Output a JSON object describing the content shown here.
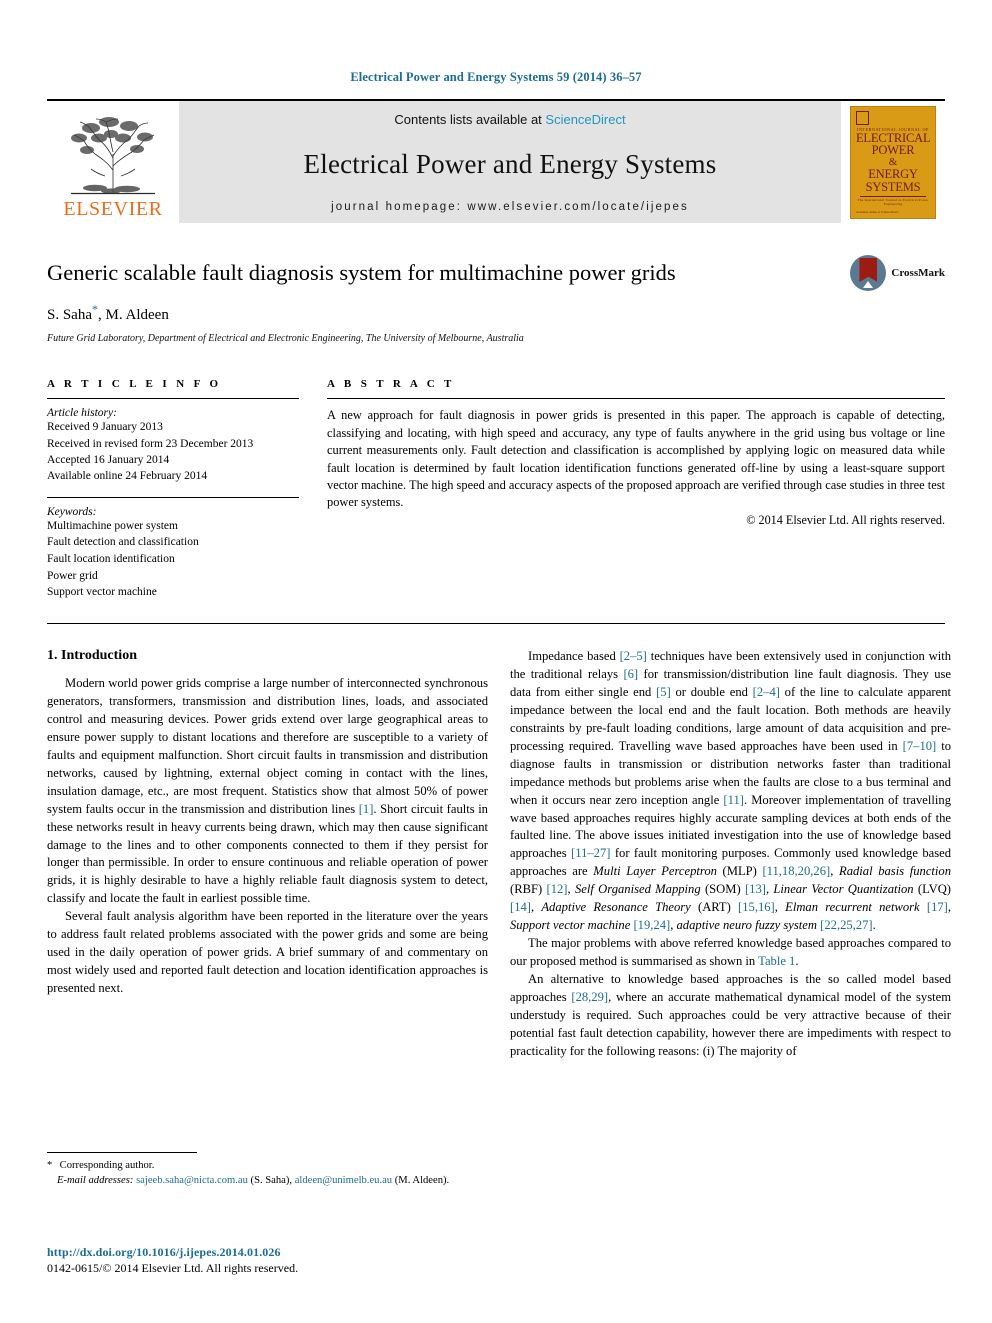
{
  "running_head": "Electrical Power and Energy Systems 59 (2014) 36–57",
  "masthead": {
    "publisher": "ELSEVIER",
    "contents_prefix": "Contents lists available at ",
    "contents_link": "ScienceDirect",
    "journal_title": "Electrical Power and Energy Systems",
    "homepage": "journal homepage: www.elsevier.com/locate/ijepes",
    "cover": {
      "line_ij": "INTERNATIONAL JOURNAL OF",
      "line1": "ELECTRICAL",
      "line2": "POWER",
      "amp": "&",
      "line3": "ENERGY",
      "line4": "SYSTEMS",
      "tagline": "The International Journal on Electrical Power Engineering",
      "bottom": "Available online at\nScienceDirect"
    }
  },
  "title_block": {
    "title": "Generic scalable fault diagnosis system for multimachine power grids",
    "authors_pre": "S. Saha",
    "author_star": "*",
    "authors_post": ", M. Aldeen",
    "affiliation": "Future Grid Laboratory, Department of Electrical and Electronic Engineering, The University of Melbourne, Australia",
    "crossmark_label": "CrossMark"
  },
  "article_info": {
    "heading": "A R T I C L E   I N F O",
    "history_label": "Article history:",
    "history": [
      "Received 9 January 2013",
      "Received in revised form 23 December 2013",
      "Accepted 16 January 2014",
      "Available online 24 February 2014"
    ],
    "keywords_label": "Keywords:",
    "keywords": [
      "Multimachine power system",
      "Fault detection and classification",
      "Fault location identification",
      "Power grid",
      "Support vector machine"
    ]
  },
  "abstract": {
    "heading": "A B S T R A C T",
    "text": "A new approach for fault diagnosis in power grids is presented in this paper. The approach is capable of detecting, classifying and locating, with high speed and accuracy, any type of faults anywhere in the grid using bus voltage or line current measurements only. Fault detection and classification is accomplished by applying logic on measured data while fault location is determined by fault location identification functions generated off-line by using a least-square support vector machine. The high speed and accuracy aspects of the proposed approach are verified through case studies in three test power systems.",
    "copyright": "© 2014 Elsevier Ltd. All rights reserved."
  },
  "body": {
    "section1_heading": "1. Introduction",
    "left_paragraphs": [
      "Modern world power grids comprise a large number of interconnected synchronous generators, transformers, transmission and distribution lines, loads, and associated control and measuring devices. Power grids extend over large geographical areas to ensure power supply to distant locations and therefore are susceptible to a variety of faults and equipment malfunction. Short circuit faults in transmission and distribution networks, caused by lightning, external object coming in contact with the lines, insulation damage, etc., are most frequent. Statistics show that almost 50% of power system faults occur in the transmission and distribution lines [1]. Short circuit faults in these networks result in heavy currents being drawn, which may then cause significant damage to the lines and to other components connected to them if they persist for longer than permissible. In order to ensure continuous and reliable operation of power grids, it is highly desirable to have a highly reliable fault diagnosis system to detect, classify and locate the fault in earliest possible time.",
      "Several fault analysis algorithm have been reported in the literature over the years to address fault related problems associated with the power grids and some are being used in the daily operation of power grids. A brief summary of and commentary on most widely used and reported fault detection and location identification approaches is presented next."
    ],
    "right_paragraphs": [
      "Impedance based [2–5] techniques have been extensively used in conjunction with the traditional relays [6] for transmission/distribution line fault diagnosis. They use data from either single end [5] or double end [2–4] of the line to calculate apparent impedance between the local end and the fault location. Both methods are heavily constraints by pre-fault loading conditions, large amount of data acquisition and pre-processing required. Travelling wave based approaches have been used in [7–10] to diagnose faults in transmission or distribution networks faster than traditional impedance methods but problems arise when the faults are close to a bus terminal and when it occurs near zero inception angle [11]. Moreover implementation of travelling wave based approaches requires highly accurate sampling devices at both ends of the faulted line. The above issues initiated investigation into the use of knowledge based approaches [11–27] for fault monitoring purposes. Commonly used knowledge based approaches are Multi Layer Perceptron (MLP) [11,18,20,26], Radial basis function (RBF) [12], Self Organised Mapping (SOM) [13], Linear Vector Quantization (LVQ) [14], Adaptive Resonance Theory (ART) [15,16], Elman recurrent network [17], Support vector machine [19,24], adaptive neuro fuzzy system [22,25,27].",
      "The major problems with above referred knowledge based approaches compared to our proposed method is summarised as shown in Table 1.",
      "An alternative to knowledge based approaches is the so called model based approaches [28,29], where an accurate mathematical dynamical model of the system understudy is required. Such approaches could be very attractive because of their potential fast fault detection capability, however there are impediments with respect to practicality for the following reasons: (i) The majority of"
    ]
  },
  "footnote": {
    "corresponding": "Corresponding author.",
    "email_label": "E-mail addresses:",
    "email1": "sajeeb.saha@nicta.com.au",
    "email1_who": " (S. Saha), ",
    "email2": "aldeen@unimelb.eu.au",
    "email2_who": " (M. Aldeen)."
  },
  "footer": {
    "doi": "http://dx.doi.org/10.1016/j.ijepes.2014.01.026",
    "issn": "0142-0615/© 2014 Elsevier Ltd. All rights reserved."
  },
  "colors": {
    "link_blue": "#1b6d94",
    "elsevier_orange": "#ed6c19",
    "cover_gold": "#d99b16",
    "masthead_grey": "#e3e3e3"
  }
}
